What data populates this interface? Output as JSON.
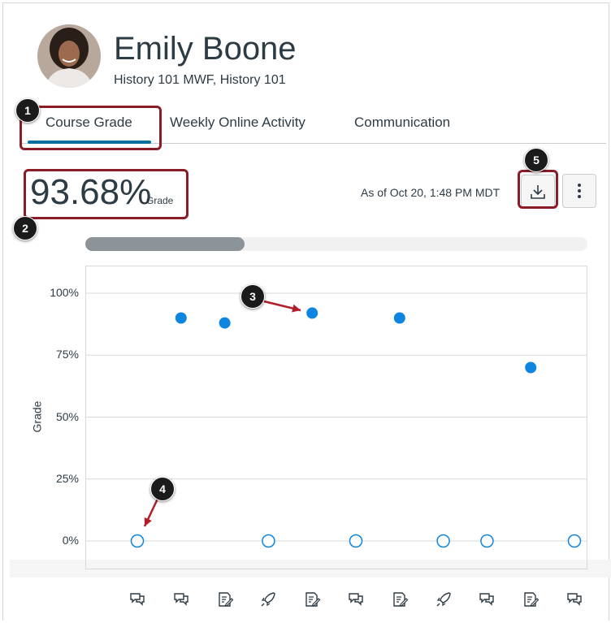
{
  "header": {
    "name": "Emily Boone",
    "course": "History 101 MWF, History 101"
  },
  "tabs": [
    {
      "label": "Course Grade",
      "selected": true
    },
    {
      "label": "Weekly Online Activity",
      "selected": false
    },
    {
      "label": "Communication",
      "selected": false
    }
  ],
  "summary": {
    "grade_value": "93.68%",
    "grade_label": "Grade",
    "as_of": "As of Oct 20, 1:48 PM MDT",
    "download_icon": "download-icon",
    "more_icon": "kebab-menu-icon"
  },
  "callouts": [
    "1",
    "2",
    "3",
    "4",
    "5"
  ],
  "colors": {
    "accent": "#0770a3",
    "point": "#0e86e0",
    "callout_border": "#8a1c28",
    "arrow": "#b01e2a"
  },
  "scroll": {
    "position_fraction": 0.0,
    "visible_fraction": 0.32
  },
  "chart_data": {
    "type": "scatter",
    "ylabel": "Grade",
    "yticks": [
      "0%",
      "25%",
      "50%",
      "75%",
      "100%"
    ],
    "ylim": [
      -12,
      112
    ],
    "grid": true,
    "x_count": 11,
    "x_icons": [
      "discussion-icon",
      "discussion-icon",
      "assignment-icon",
      "quiz-icon",
      "assignment-icon",
      "discussion-icon",
      "assignment-icon",
      "quiz-icon",
      "discussion-icon",
      "assignment-icon",
      "discussion-icon"
    ],
    "series": [
      {
        "filled": true,
        "points": [
          {
            "x": 2,
            "y": 90
          },
          {
            "x": 3,
            "y": 88
          },
          {
            "x": 5,
            "y": 92
          },
          {
            "x": 7,
            "y": 90
          },
          {
            "x": 10,
            "y": 70
          }
        ]
      },
      {
        "filled": false,
        "points": [
          {
            "x": 1,
            "y": 0
          },
          {
            "x": 4,
            "y": 0
          },
          {
            "x": 6,
            "y": 0
          },
          {
            "x": 8,
            "y": 0
          },
          {
            "x": 9,
            "y": 0
          },
          {
            "x": 11,
            "y": 0
          }
        ]
      }
    ]
  }
}
